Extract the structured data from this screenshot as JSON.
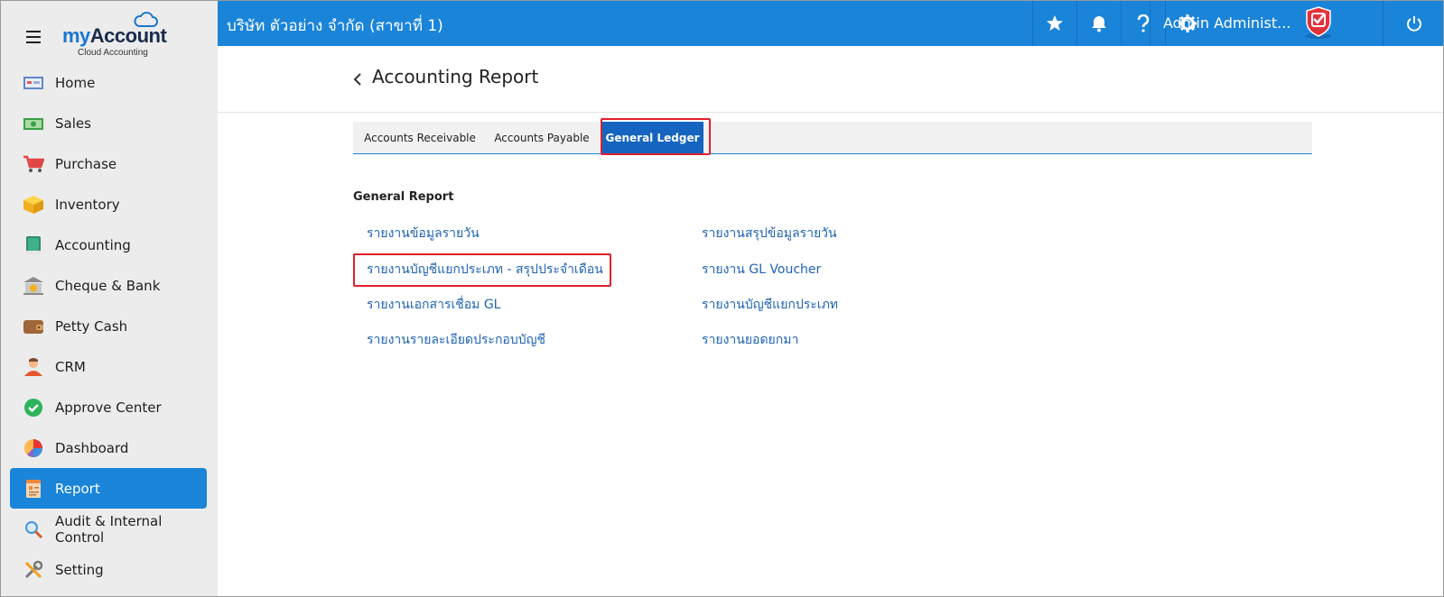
{
  "brand": {
    "name_my": "my",
    "name_account": "Account",
    "subtitle": "Cloud Accounting"
  },
  "sidebar": {
    "items": [
      {
        "label": "Home",
        "icon": "home-icon"
      },
      {
        "label": "Sales",
        "icon": "money-icon"
      },
      {
        "label": "Purchase",
        "icon": "cart-icon"
      },
      {
        "label": "Inventory",
        "icon": "box-icon"
      },
      {
        "label": "Accounting",
        "icon": "ledger-book-icon"
      },
      {
        "label": "Cheque & Bank",
        "icon": "bank-icon"
      },
      {
        "label": "Petty Cash",
        "icon": "wallet-icon"
      },
      {
        "label": "CRM",
        "icon": "person-icon"
      },
      {
        "label": "Approve Center",
        "icon": "check-circle-icon"
      },
      {
        "label": "Dashboard",
        "icon": "pie-chart-icon"
      },
      {
        "label": "Report",
        "icon": "report-icon",
        "active": true
      },
      {
        "label": "Audit & Internal Control",
        "icon": "magnifier-icon"
      },
      {
        "label": "Setting",
        "icon": "tools-icon"
      }
    ]
  },
  "header": {
    "company": "บริษัท ตัวอย่าง จำกัด (สาขาที่ 1)",
    "user": "Admin Administ...",
    "icons": [
      "star-icon",
      "bell-icon",
      "help-icon",
      "gear-icon",
      "shield-badge-icon",
      "power-icon"
    ]
  },
  "page": {
    "title": "Accounting Report"
  },
  "tabs": [
    {
      "label": "Accounts Receivable"
    },
    {
      "label": "Accounts Payable"
    },
    {
      "label": "General Ledger",
      "active": true
    }
  ],
  "report": {
    "section_title": "General Report",
    "left_links": [
      "รายงานข้อมูลรายวัน",
      "รายงานบัญชีแยกประเภท - สรุปประจำเดือน",
      "รายงานเอกสารเชื่อม GL",
      "รายงานรายละเอียดประกอบบัญชี"
    ],
    "right_links": [
      "รายงานสรุปข้อมูลรายวัน",
      "รายงาน GL Voucher",
      "รายงานบัญชีแยกประเภท",
      "รายงานยอดยกมา"
    ]
  },
  "colors": {
    "primary": "#1a84d9",
    "active_tab": "#1565c0",
    "highlight": "#e01f2a",
    "link": "#1e63b5",
    "sidebar_bg": "#ececec"
  }
}
